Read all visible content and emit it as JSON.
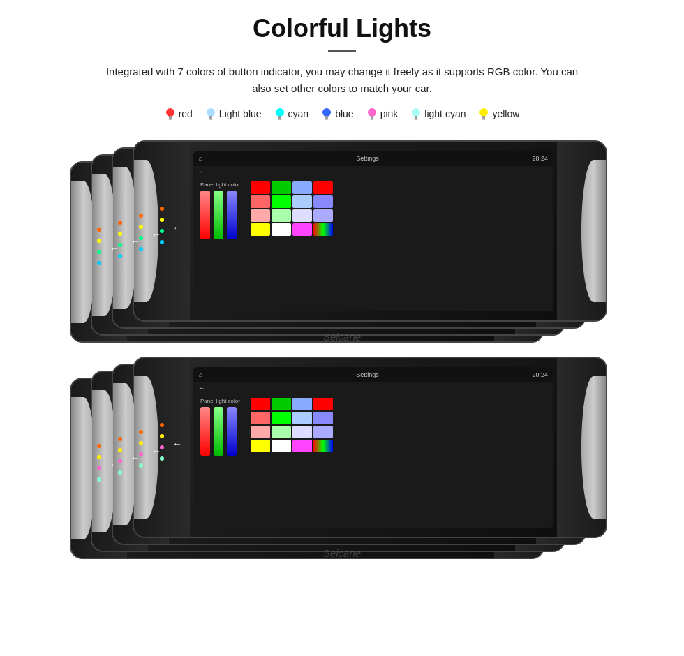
{
  "page": {
    "title": "Colorful Lights",
    "description": "Integrated with 7 colors of button indicator, you may change it freely as it supports RGB color. You can also set other colors to match your car.",
    "colors": [
      {
        "name": "red",
        "color": "#ff3333",
        "bulb_char": "🔴"
      },
      {
        "name": "Light blue",
        "color": "#aaddff",
        "bulb_char": "💧"
      },
      {
        "name": "cyan",
        "color": "#00ffff",
        "bulb_char": "💧"
      },
      {
        "name": "blue",
        "color": "#3366ff",
        "bulb_char": "💧"
      },
      {
        "name": "pink",
        "color": "#ff66cc",
        "bulb_char": "💗"
      },
      {
        "name": "light cyan",
        "color": "#aaffee",
        "bulb_char": "💧"
      },
      {
        "name": "yellow",
        "color": "#ffee00",
        "bulb_char": "💛"
      }
    ],
    "watermark": "Seicane",
    "screen": {
      "time": "20:24",
      "title": "Settings",
      "panel_label": "Panel light color",
      "back_arrow": "←"
    },
    "color_grid_row1": [
      "#ff0000",
      "#00ff00",
      "#00aaff",
      "#aa44ff",
      "#ff4444",
      "#00ff00",
      "#aaddff",
      "#8888ff",
      "#ffaaaa",
      "#aaffaa",
      "#ddddff",
      "#aaaaff",
      "#ffff00",
      "#ffffff",
      "#ff44ff",
      "#ff66ff"
    ],
    "color_grid_row2": [
      "#ff0000",
      "#00ff00",
      "#00aaff",
      "#aa44ff",
      "#ff4444",
      "#00ff00",
      "#aaddff",
      "#8888ff",
      "#ffaaaa",
      "#aaffaa",
      "#ddddff",
      "#aaaaff",
      "#ffff00",
      "#ffffff",
      "#ff44ff",
      "#ff66ff"
    ]
  }
}
